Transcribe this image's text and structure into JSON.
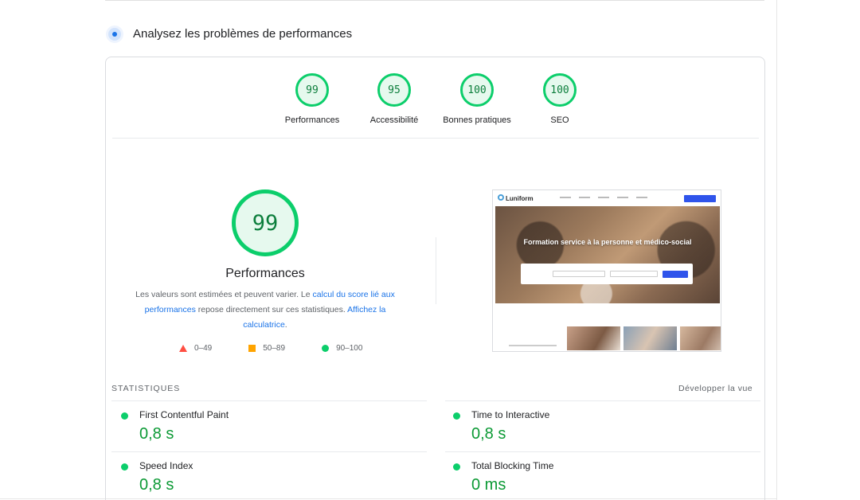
{
  "section": {
    "title": "Analysez les problèmes de performances",
    "icon": "speed-icon"
  },
  "categories": [
    {
      "label": "Performances",
      "score": "99"
    },
    {
      "label": "Accessibilité",
      "score": "95"
    },
    {
      "label": "Bonnes pratiques",
      "score": "100"
    },
    {
      "label": "SEO",
      "score": "100"
    }
  ],
  "main_score": {
    "value": "99",
    "label": "Performances",
    "desc_1": "Les valeurs sont estimées et peuvent varier. Le ",
    "desc_link_1": "calcul du score lié aux performances",
    "desc_2": " repose directement sur ces statistiques. ",
    "desc_link_2": "Affichez la calculatrice",
    "desc_3": "."
  },
  "legend": {
    "fail": "0–49",
    "average": "50–89",
    "pass": "90–100"
  },
  "screenshot": {
    "brand": "Luniform",
    "headline": "Formation service à la personne et médico-social"
  },
  "statistics": {
    "heading": "STATISTIQUES",
    "expand_label": "Développer la vue",
    "metrics": [
      {
        "name": "First Contentful Paint",
        "value": "0,8 s"
      },
      {
        "name": "Time to Interactive",
        "value": "0,8 s"
      },
      {
        "name": "Speed Index",
        "value": "0,8 s"
      },
      {
        "name": "Total Blocking Time",
        "value": "0 ms"
      }
    ]
  },
  "colors": {
    "pass": "#0cce6b",
    "average": "#ffa400",
    "fail": "#ff4e42",
    "link": "#1a73e8"
  }
}
